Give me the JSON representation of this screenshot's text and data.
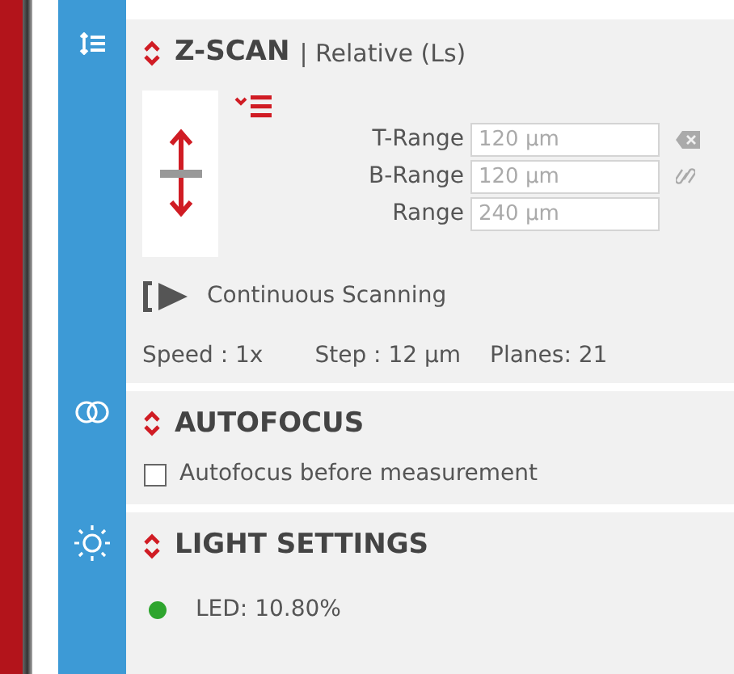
{
  "sections": [
    {
      "kind": "zscan",
      "title": "Z-SCAN",
      "subtitle": "| Relative (Ls)",
      "fields": [
        {
          "label": "T-Range",
          "value": "120 µm",
          "disabled": true
        },
        {
          "label": "B-Range",
          "value": "120 µm",
          "disabled": true
        },
        {
          "label": "Range",
          "value": "240 µm",
          "disabled": true
        }
      ],
      "mode": "Continuous Scanning",
      "stats": [
        "Speed : 1x",
        "Step : 12 µm",
        "Planes: 21"
      ]
    },
    {
      "kind": "autofocus",
      "title": "AUTOFOCUS",
      "options": [
        {
          "label": "Autofocus before measurement",
          "checked": false
        }
      ]
    },
    {
      "kind": "light",
      "title": "LIGHT SETTINGS",
      "led": {
        "label": "LED: 10.80%",
        "on": true
      }
    }
  ]
}
